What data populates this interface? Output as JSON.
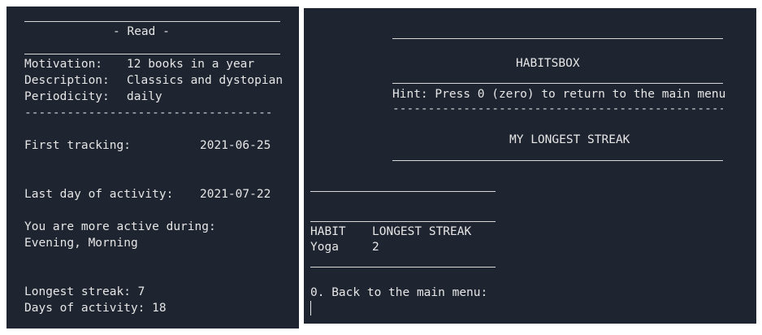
{
  "left_panel": {
    "title": "- Read -",
    "motivation_label": "Motivation:",
    "motivation_value": "12 books in a year",
    "description_label": "Description:",
    "description_value": "Classics and dystopian",
    "periodicity_label": "Periodicity:",
    "periodicity_value": "daily",
    "separator": "-----------------------------------",
    "first_tracking_label": "First tracking:",
    "first_tracking_value": "2021-06-25",
    "last_day_label": "Last day of activity:",
    "last_day_value": "2021-07-22",
    "active_during_label": "You are more active during:",
    "active_during_value": "Evening, Morning",
    "longest_streak": "Longest streak: 7",
    "days_of_activity": "Days of activity: 18"
  },
  "right_panel": {
    "app_title": "HABITSBOX",
    "hint": "Hint: Press 0 (zero) to return to the main menu",
    "separator": "-----------------------------------------------",
    "section_title": "MY LONGEST STREAK",
    "table": {
      "headers": [
        "HABIT",
        "LONGEST STREAK"
      ],
      "rows": [
        [
          "Yoga",
          "2"
        ]
      ]
    },
    "prompt": "0. Back to the main menu:"
  }
}
